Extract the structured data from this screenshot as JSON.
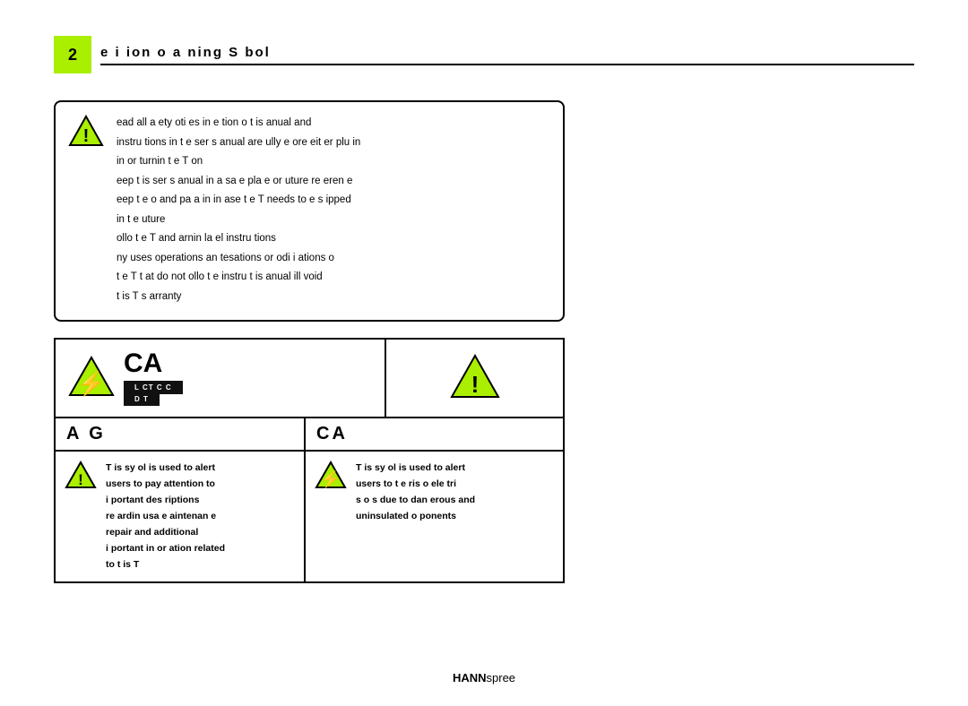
{
  "page_number": "2",
  "header_title": "e  i  ion o   a ning S   bol",
  "top_warning": {
    "lines": [
      "ead all  a ety  oti es in  e tion  o  t is  anual and",
      "instru  tions in t e  ser s  anual  are ully  e ore eit  er plu  in",
      "in or turnin  t e T  on",
      "eep t is  ser s  anual in a sa e pla e  or  uture re eren e",
      "eep t e  o  and pa  a in  in  ase t e T  needs to  e s ipped",
      "in t e  uture",
      "ollo  t e T  and   arnin  la el instru tions",
      "ny uses  operations    an tesations or  odi i ations o",
      "t e T  t at do not ollo  t e instru t is  anual  ill void",
      "t is T s  arranty"
    ]
  },
  "electric_ca_box": {
    "ca_text": "CA",
    "subbar1": "L  CT  C      C",
    "subbar2": "D    T"
  },
  "bottom_left": {
    "header": "A    G",
    "icon": "warning",
    "text_lines": [
      "T is sy   ol is used to alert",
      "users to pay attention to",
      "i  portant des riptions",
      "re  ardin  usa e   aintenan e",
      "repair  and additional",
      "i  portant in or  ation related",
      "to t is T"
    ]
  },
  "bottom_right": {
    "header": "CA",
    "icon": "electric",
    "text_lines": [
      "T is sy   ol is used to alert",
      "users to t e ris  o  ele tri",
      "s o  s due to dan erous and",
      "uninsulated  o  ponents"
    ]
  },
  "footer": {
    "brand_bold": "HANN",
    "brand_light": "spree"
  }
}
